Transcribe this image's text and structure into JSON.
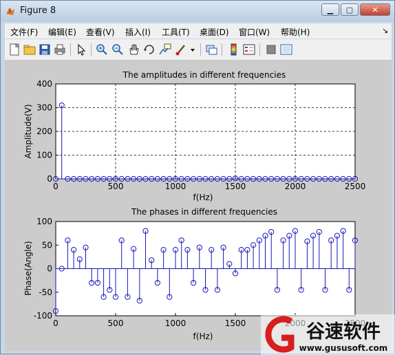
{
  "window": {
    "title": "Figure 8"
  },
  "menu": [
    "文件(F)",
    "编辑(E)",
    "查看(V)",
    "插入(I)",
    "工具(T)",
    "桌面(D)",
    "窗口(W)",
    "帮助(H)"
  ],
  "menu_arrow": "↘",
  "toolbar_icons": [
    "new-figure-icon",
    "open-icon",
    "save-icon",
    "print-icon",
    "pointer-icon",
    "zoom-in-icon",
    "zoom-out-icon",
    "pan-icon",
    "rotate-3d-icon",
    "data-cursor-icon",
    "brush-icon",
    "brush-dropdown-icon",
    "link-plot-icon",
    "insert-colorbar-icon",
    "insert-legend-icon",
    "hide-plot-tools-icon",
    "show-plot-tools-icon"
  ],
  "chart_data": [
    {
      "type": "stem",
      "title": "The amplitudes in different frequencies",
      "xlabel": "f(Hz)",
      "ylabel": "Amplitude(V)",
      "xlim": [
        0,
        2500
      ],
      "ylim": [
        0,
        400
      ],
      "xticks": [
        0,
        500,
        1000,
        1500,
        2000,
        2500
      ],
      "yticks": [
        0,
        100,
        200,
        300,
        400
      ],
      "grid": true,
      "x": [
        0,
        50,
        100,
        150,
        200,
        250,
        300,
        350,
        400,
        450,
        500,
        550,
        600,
        650,
        700,
        750,
        800,
        850,
        900,
        950,
        1000,
        1050,
        1100,
        1150,
        1200,
        1250,
        1300,
        1350,
        1400,
        1450,
        1500,
        1550,
        1600,
        1650,
        1700,
        1750,
        1800,
        1850,
        1900,
        1950,
        2000,
        2050,
        2100,
        2150,
        2200,
        2250,
        2300,
        2350,
        2400,
        2450,
        2500
      ],
      "y": [
        0,
        310,
        0,
        0,
        0,
        0,
        0,
        0,
        0,
        0,
        0,
        0,
        0,
        0,
        0,
        0,
        0,
        0,
        0,
        0,
        0,
        0,
        0,
        0,
        0,
        0,
        0,
        0,
        0,
        0,
        2,
        0,
        0,
        0,
        0,
        0,
        0,
        0,
        0,
        0,
        0,
        0,
        0,
        0,
        0,
        0,
        0,
        0,
        0,
        0,
        0
      ]
    },
    {
      "type": "stem",
      "title": "The phases in different frequencies",
      "xlabel": "f(Hz)",
      "ylabel": "Phase(Angle)",
      "xlim": [
        0,
        2500
      ],
      "ylim": [
        -100,
        100
      ],
      "xticks": [
        0,
        500,
        1000,
        1500,
        2000,
        2500
      ],
      "yticks": [
        -100,
        -50,
        0,
        50,
        100
      ],
      "grid": false,
      "x": [
        0,
        50,
        100,
        150,
        200,
        250,
        300,
        350,
        400,
        450,
        500,
        550,
        600,
        650,
        700,
        750,
        800,
        850,
        900,
        950,
        1000,
        1050,
        1100,
        1150,
        1200,
        1250,
        1300,
        1350,
        1400,
        1450,
        1500,
        1550,
        1600,
        1650,
        1700,
        1750,
        1800,
        1850,
        1900,
        1950,
        2000,
        2050,
        2100,
        2150,
        2200,
        2250,
        2300,
        2350,
        2400,
        2450,
        2500
      ],
      "y": [
        -90,
        0,
        60,
        40,
        20,
        45,
        -30,
        -30,
        -60,
        -45,
        -60,
        60,
        -60,
        42,
        -68,
        80,
        18,
        -30,
        40,
        -60,
        40,
        60,
        40,
        -30,
        45,
        -45,
        40,
        -45,
        45,
        10,
        -10,
        40,
        40,
        50,
        60,
        70,
        78,
        -45,
        60,
        70,
        80,
        -45,
        58,
        70,
        78,
        -45,
        60,
        70,
        80,
        -45,
        60
      ]
    }
  ],
  "watermark": {
    "logo_text": "谷速软件",
    "url": "www.gususoft.com"
  }
}
